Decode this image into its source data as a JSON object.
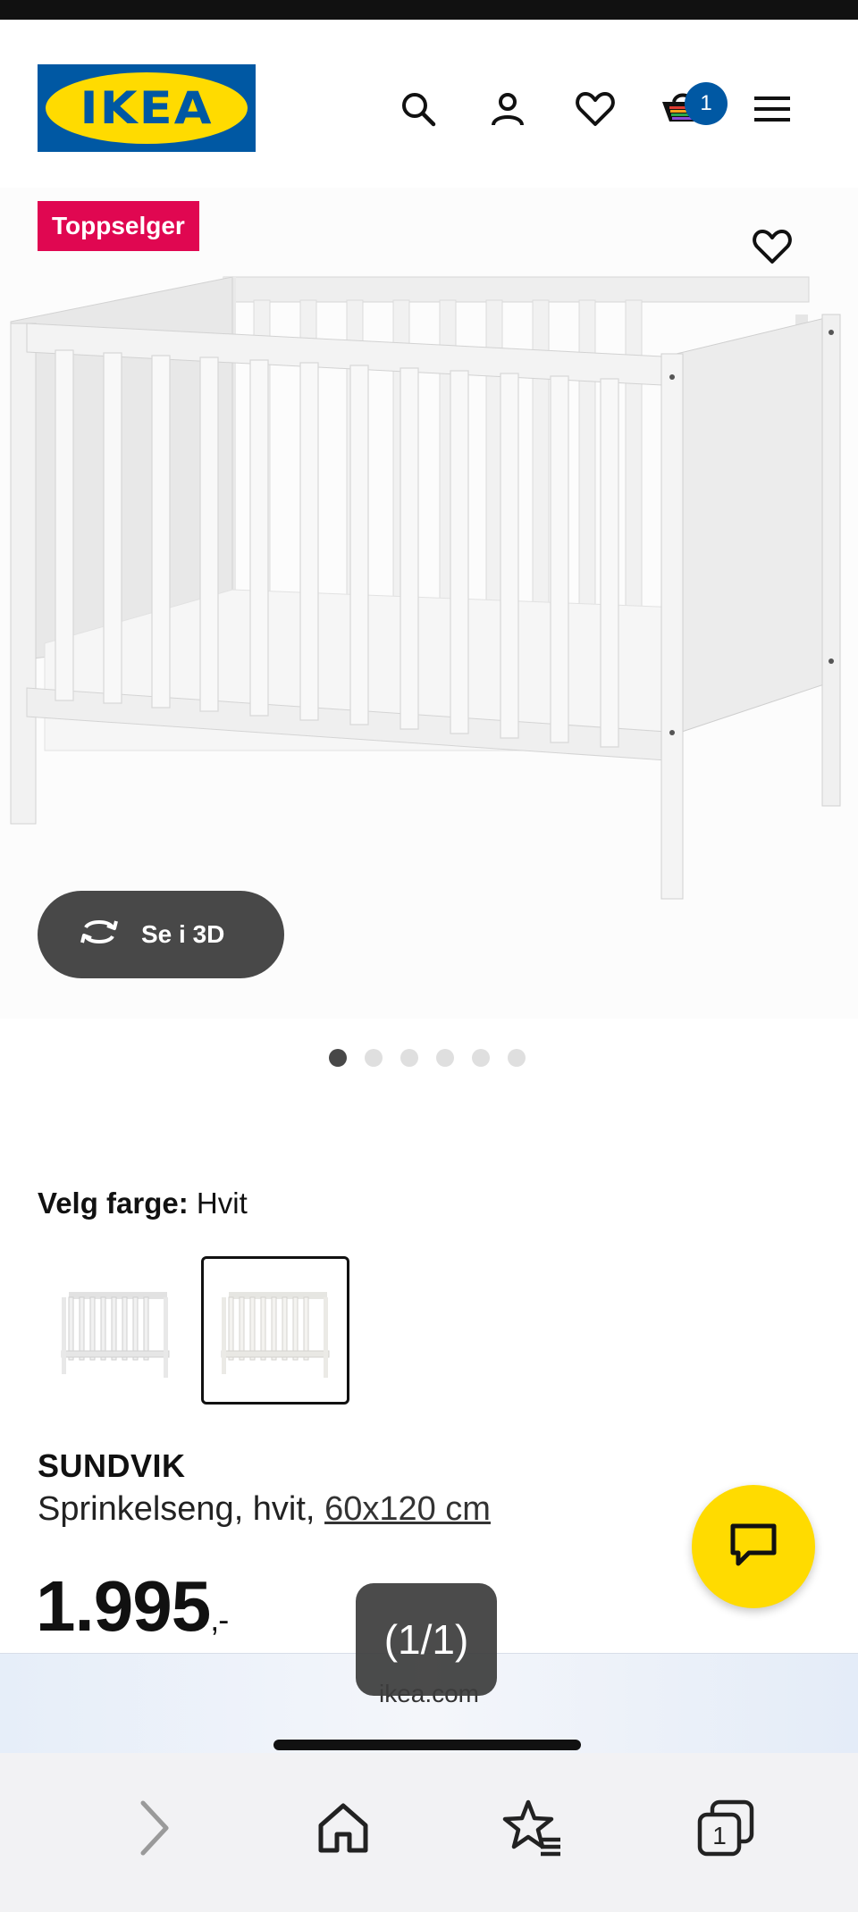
{
  "header": {
    "logo_text": "IKEA",
    "cart_count": "1",
    "icons": [
      "search-icon",
      "user-icon",
      "heart-icon",
      "cart-icon",
      "menu-icon"
    ]
  },
  "product": {
    "badge": "Toppselger",
    "view_3d_label": "Se i 3D",
    "gallery_images": 6,
    "gallery_active": 1,
    "color_label": "Velg farge:",
    "color_value": "Hvit",
    "name": "SUNDVIK",
    "description": "Sprinkelseng, hvit,",
    "size_link": "60x120 cm",
    "price_main": "1.995",
    "price_suffix": ",-"
  },
  "browser": {
    "toast": "(1/1)",
    "domain": "ikea.com",
    "tab_count": "1"
  },
  "colors": {
    "ikea_blue": "#0058a3",
    "ikea_yellow": "#ffdb00",
    "badge_red": "#e00751",
    "dark_gray": "#484848"
  }
}
